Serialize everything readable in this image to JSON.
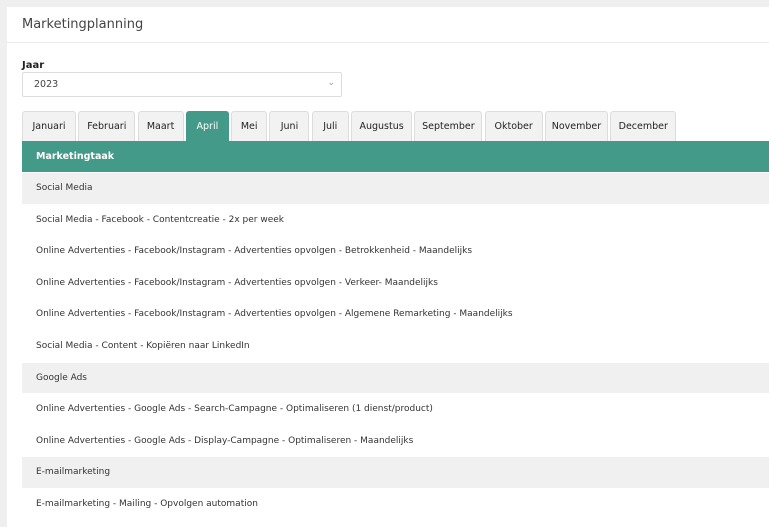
{
  "title": "Marketingplanning",
  "year": {
    "label": "Jaar",
    "value": "2023"
  },
  "tabs": [
    "Januari",
    "Februari",
    "Maart",
    "April",
    "Mei",
    "Juni",
    "Juli",
    "Augustus",
    "September",
    "Oktober",
    "November",
    "December"
  ],
  "active_tab": "April",
  "table": {
    "header": "Marketingtaak",
    "rows": [
      {
        "text": "Social Media",
        "group": true
      },
      {
        "text": "Social Media - Facebook - Contentcreatie - 2x per week",
        "group": false
      },
      {
        "text": "Online Advertenties - Facebook/Instagram - Advertenties opvolgen - Betrokkenheid - Maandelijks",
        "group": false
      },
      {
        "text": "Online Advertenties - Facebook/Instagram - Advertenties opvolgen - Verkeer- Maandelijks",
        "group": false
      },
      {
        "text": "Online Advertenties - Facebook/Instagram - Advertenties opvolgen - Algemene Remarketing - Maandelijks",
        "group": false
      },
      {
        "text": "Social Media - Content - Kopiëren naar LinkedIn",
        "group": false
      },
      {
        "text": "Google Ads",
        "group": true
      },
      {
        "text": "Online Advertenties - Google Ads - Search-Campagne - Optimaliseren (1 dienst/product)",
        "group": false
      },
      {
        "text": "Online Advertenties - Google Ads - Display-Campagne - Optimaliseren - Maandelijks",
        "group": false
      },
      {
        "text": "E-mailmarketing",
        "group": true
      },
      {
        "text": "E-mailmarketing - Mailing - Opvolgen automation",
        "group": false
      }
    ]
  },
  "colors": {
    "accent": "#449a88",
    "group_bg": "#f0f0f0"
  }
}
